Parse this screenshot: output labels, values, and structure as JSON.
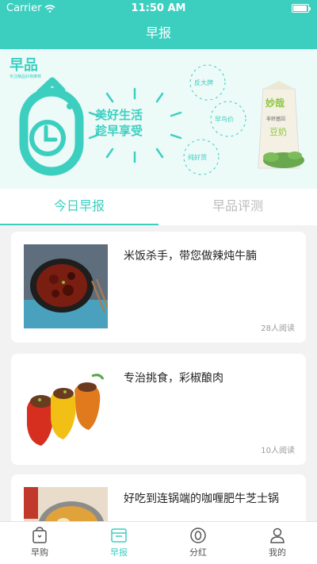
{
  "status_bar": {
    "carrier": "Carrier",
    "time": "11:50 AM"
  },
  "navbar": {
    "title": "早报"
  },
  "banner": {
    "logo_text": "早品",
    "logo_tagline": "专注精品好物推荐",
    "slogan_line1": "美好生活",
    "slogan_line2": "趁早享受",
    "tags": [
      "反大牌",
      "早鸟价",
      "纯好货"
    ],
    "product_label": "妙哉",
    "product_sublabel": "非转基因",
    "product_name": "豆奶"
  },
  "tabs": [
    {
      "label": "今日早报",
      "active": true
    },
    {
      "label": "早品评测",
      "active": false
    }
  ],
  "articles": [
    {
      "title": "米饭杀手，带您做辣炖牛腩",
      "reads": "28人阅读",
      "image": "braised-beef-photo"
    },
    {
      "title": "专治挑食，彩椒酿肉",
      "reads": "10人阅读",
      "image": "stuffed-peppers-photo"
    },
    {
      "title": "好吃到连锅端的咖喱肥牛芝士锅",
      "reads": "",
      "image": "curry-cheese-pot-photo"
    }
  ],
  "tabbar": [
    {
      "label": "早购",
      "icon": "bag-icon",
      "active": false
    },
    {
      "label": "早报",
      "icon": "newspaper-icon",
      "active": true
    },
    {
      "label": "分红",
      "icon": "coin-icon",
      "active": false
    },
    {
      "label": "我的",
      "icon": "user-icon",
      "active": false
    }
  ],
  "colors": {
    "accent": "#3ccfc0",
    "background": "#f2f2f2"
  }
}
